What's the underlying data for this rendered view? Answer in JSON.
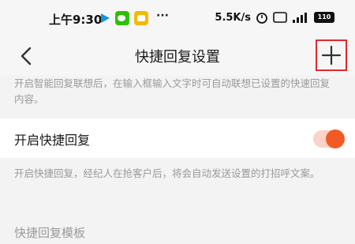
{
  "status_bar": {
    "time": "上午9:30",
    "network_speed": "5.5K/s",
    "battery": "110"
  },
  "nav": {
    "title": "快捷回复设置"
  },
  "settings": {
    "association_desc": "开启智能回复联想后，在输入框输入文字时可自动联想已设置的快速回复内容。",
    "quick_reply_label": "开启快捷回复",
    "quick_reply_enabled": true,
    "quick_reply_desc": "开启快捷回复，经纪人在抢客户后，将会自动发送设置的打招呼文案。",
    "template_section": "快捷回复模板"
  },
  "colors": {
    "accent": "#f25a24",
    "toggle_track": "#fbd3c8",
    "highlight_box": "#e0282e"
  }
}
